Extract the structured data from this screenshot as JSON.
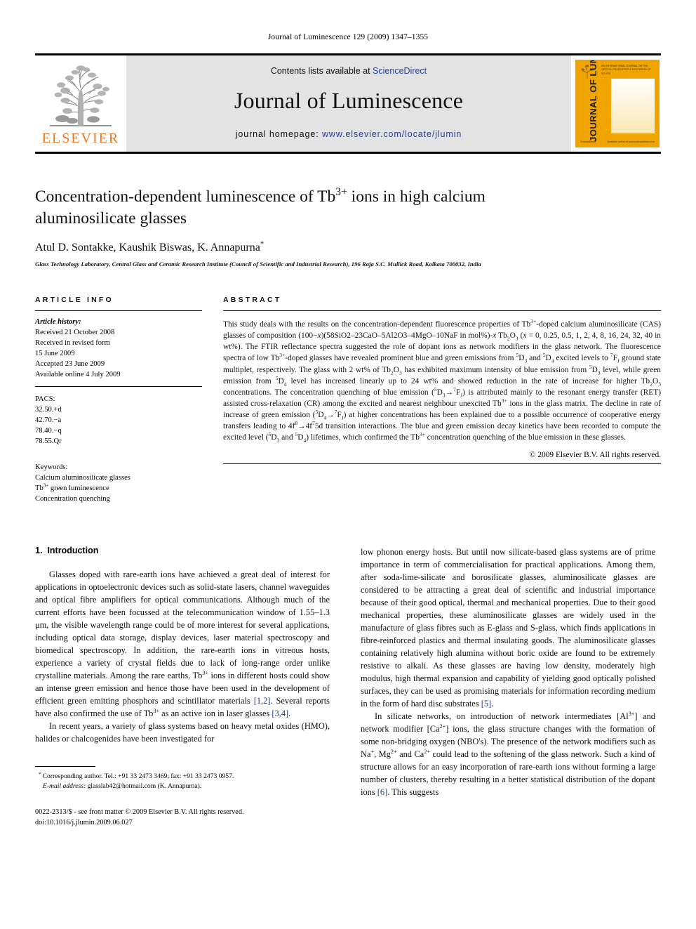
{
  "running_head": "Journal of Luminescence 129 (2009) 1347–1355",
  "masthead": {
    "contents_prefix": "Contents lists available at ",
    "sciencedirect": "ScienceDirect",
    "journal_title": "Journal of Luminescence",
    "homepage_prefix": "journal homepage: ",
    "homepage_url": "www.elsevier.com/locate/jlumin",
    "elsevier_wordmark": "ELSEVIER",
    "cover_title": "JOURNAL OF LUMINESCENCE",
    "cover_topline": "AN INTERNATIONAL JOURNAL ON THE\nOPTICAL PROPERTIES & EXCITATION OF SOLIDS",
    "cover_footer_left": "ScienceDirect",
    "cover_footer_right": "Available online at www.sciencedirect.com",
    "accent_link_color": "#2a3f8f",
    "elsevier_orange": "#e87722",
    "cover_yellow": "#f0a400"
  },
  "title": {
    "line1_a": "Concentration-dependent luminescence of Tb",
    "line1_sup": "3+",
    "line1_b": " ions in high calcium",
    "line2": "aluminosilicate glasses"
  },
  "authors": "Atul D. Sontakke, Kaushik Biswas, K. Annapurna",
  "affiliation": "Glass Technology Laboratory, Central Glass and Ceramic Research Institute (Council of Scientific and Industrial Research), 196 Raja S.C. Mullick Road, Kolkata 700032, India",
  "article_info": {
    "heading": "ARTICLE INFO",
    "history_label": "Article history:",
    "history": [
      "Received 21 October 2008",
      "Received in revised form",
      "15 June 2009",
      "Accepted 23 June 2009",
      "Available online 4 July 2009"
    ],
    "pacs_label": "PACS:",
    "pacs": [
      "32.50.+d",
      "42.70.−a",
      "78.40.−q",
      "78.55.Qr"
    ],
    "keywords_label": "Keywords:",
    "keywords": [
      "Calcium aluminosilicate glasses",
      "Tb3+ green luminescence",
      "Concentration quenching"
    ],
    "keyword_tb_prefix": "Tb",
    "keyword_tb_sup": "3+",
    "keyword_tb_suffix": " green luminescence"
  },
  "abstract": {
    "heading": "ABSTRACT",
    "text": "This study deals with the results on the concentration-dependent fluorescence properties of Tb3+-doped calcium aluminosilicate (CAS) glasses of composition (100−x)(58SiO2–23CaO–5Al2O3–4MgO–10NaF in mol%)-x Tb2O3 (x = 0, 0.25, 0.5, 1, 2, 4, 8, 16, 24, 32, 40 in wt%). The FTIR reflectance spectra suggested the role of dopant ions as network modifiers in the glass network. The fluorescence spectra of low Tb3+-doped glasses have revealed prominent blue and green emissions from 5D3 and 5D4 excited levels to 7FJ ground state multiplet, respectively. The glass with 2 wt% of Tb2O3 has exhibited maximum intensity of blue emission from 5D3 level, while green emission from 5D4 level has increased linearly up to 24 wt% and showed reduction in the rate of increase for higher Tb2O3 concentrations. The concentration quenching of blue emission (5D3→7FJ) is attributed mainly to the resonant energy transfer (RET) assisted cross-relaxation (CR) among the excited and nearest neighbour unexcited Tb3+ ions in the glass matrix. The decline in rate of increase of green emission (5D4→7FJ) at higher concentrations has been explained due to a possible occurrence of cooperative energy transfers leading to 4f8→4f75d transition interactions. The blue and green emission decay kinetics have been recorded to compute the excited level (5D3 and 5D4) lifetimes, which confirmed the Tb3+ concentration quenching of the blue emission in these glasses.",
    "copyright": "© 2009 Elsevier B.V. All rights reserved."
  },
  "section": {
    "number": "1.",
    "heading": "Introduction"
  },
  "body": {
    "left_p1": "Glasses doped with rare-earth ions have achieved a great deal of interest for applications in optoelectronic devices such as solid-state lasers, channel waveguides and optical fibre amplifiers for optical communications. Although much of the current efforts have been focussed at the telecommunication window of 1.55–1.3 μm, the visible wavelength range could be of more interest for several applications, including optical data storage, display devices, laser material spectroscopy and biomedical spectroscopy. In addition, the rare-earth ions in vitreous hosts, experience a variety of crystal fields due to lack of long-range order unlike crystalline materials. Among the rare earths, Tb3+ ions in different hosts could show an intense green emission and hence those have been used in the development of efficient green emitting phosphors and scintillator materials [1,2]. Several reports have also confirmed the use of Tb3+ as an active ion in laser glasses [3,4].",
    "left_p2": "In recent years, a variety of glass systems based on heavy metal oxides (HMO), halides or chalcogenides have been investigated for",
    "right_p1": "low phonon energy hosts. But until now silicate-based glass systems are of prime importance in term of commercialisation for practical applications. Among them, after soda-lime-silicate and borosilicate glasses, aluminosilicate glasses are considered to be attracting a great deal of scientific and industrial importance because of their good optical, thermal and mechanical properties. Due to their good mechanical properties, these aluminosilicate glasses are widely used in the manufacture of glass fibres such as E-glass and S-glass, which finds applications in fibre-reinforced plastics and thermal insulating goods. The aluminosilicate glasses containing relatively high alumina without boric oxide are found to be extremely resistive to alkali. As these glasses are having low density, moderately high modulus, high thermal expansion and capability of yielding good optically polished surfaces, they can be used as promising materials for information recording medium in the form of hard disc substrates [5].",
    "right_p2": "In silicate networks, on introduction of network intermediates [Al3+] and network modifier [Ca2+] ions, the glass structure changes with the formation of some non-bridging oxygen (NBO's). The presence of the network modifiers such as Na+, Mg2+ and Ca2+ could lead to the softening of the glass network. Such a kind of structure allows for an easy incorporation of rare-earth ions without forming a large number of clusters, thereby resulting in a better statistical distribution of the dopant ions [6]. This suggests"
  },
  "footnote": {
    "marker": "*",
    "corresponding": "Corresponding author. Tel.: +91 33 2473 3469; fax: +91 33 2473 0957.",
    "email_label": "E-mail address:",
    "email": "glasslab42@hotmail.com (K. Annapurna)."
  },
  "imprint": {
    "line1": "0022-2313/$ - see front matter © 2009 Elsevier B.V. All rights reserved.",
    "line2": "doi:10.1016/j.jlumin.2009.06.027"
  }
}
